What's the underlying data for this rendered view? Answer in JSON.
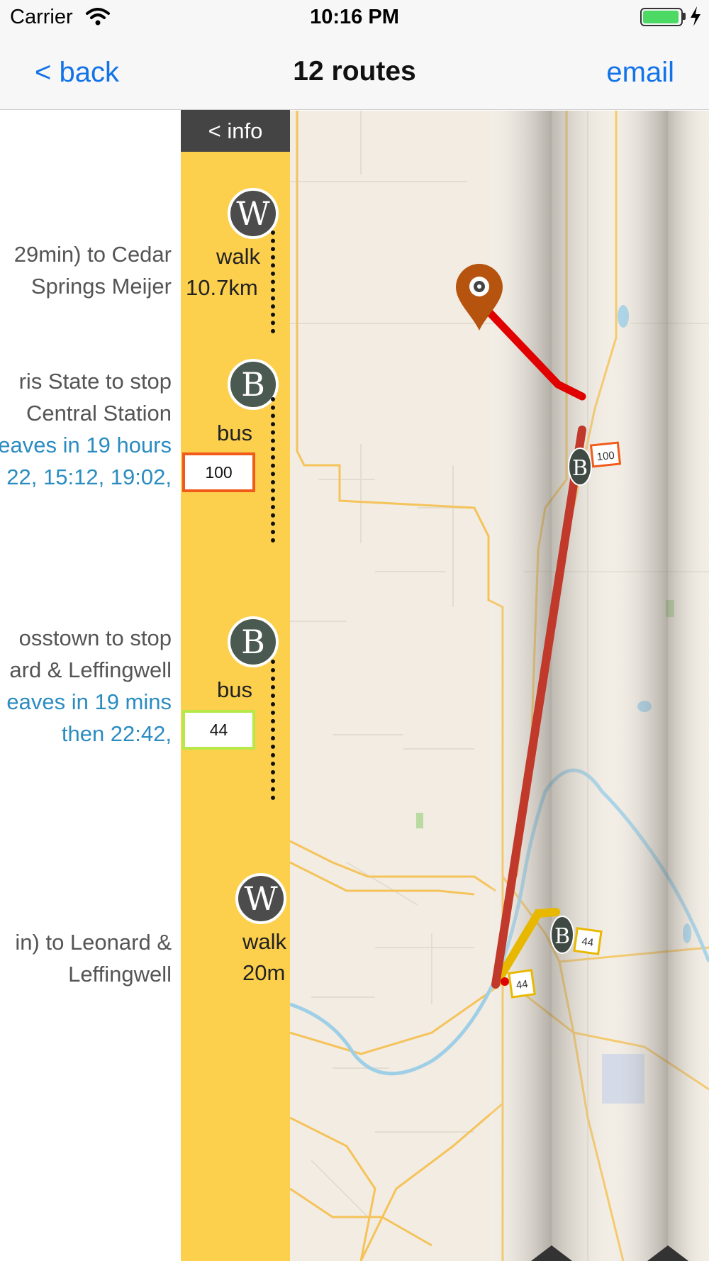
{
  "status_bar": {
    "carrier": "Carrier",
    "time": "10:16 PM",
    "battery_icon": "battery-charging-icon",
    "wifi_icon": "wifi-icon"
  },
  "nav": {
    "back_label": "< back",
    "title": "12 routes",
    "email_label": "email"
  },
  "info_button": "< info",
  "steps": [
    {
      "type": "walk",
      "icon_letter": "W",
      "mode_label": "walk",
      "distance": "10.7km",
      "text_line1": "29min) to Cedar",
      "text_line2": "Springs Meijer"
    },
    {
      "type": "bus",
      "icon_letter": "B",
      "mode_label": "bus",
      "route": "100",
      "route_color": "#f05a1a",
      "text_line1": "ris State  to stop",
      "text_line2": "Central Station",
      "time_line1": "eaves in 19 hours",
      "time_line2": "22, 15:12, 19:02,"
    },
    {
      "type": "bus",
      "icon_letter": "B",
      "mode_label": "bus",
      "route": "44",
      "route_color": "#b6e84a",
      "text_line1": "osstown  to stop",
      "text_line2": "ard & Leffingwell",
      "time_line1": "eaves in 19 mins",
      "time_line2": "then 22:42,"
    },
    {
      "type": "walk",
      "icon_letter": "W",
      "mode_label": "walk",
      "distance": "20m",
      "text_line1": "in) to Leonard &",
      "text_line2": "Leffingwell"
    }
  ],
  "map": {
    "marker_labels": [
      "100",
      "44",
      "44"
    ],
    "stop_icon_letters": [
      "B",
      "B"
    ],
    "colors": {
      "route_100_line": "#c0392b",
      "route_44_line": "#e8b800",
      "walk_line": "#e00000",
      "pin": "#b5530f",
      "accent": "#1273e8",
      "strip": "#fcd04d"
    }
  }
}
